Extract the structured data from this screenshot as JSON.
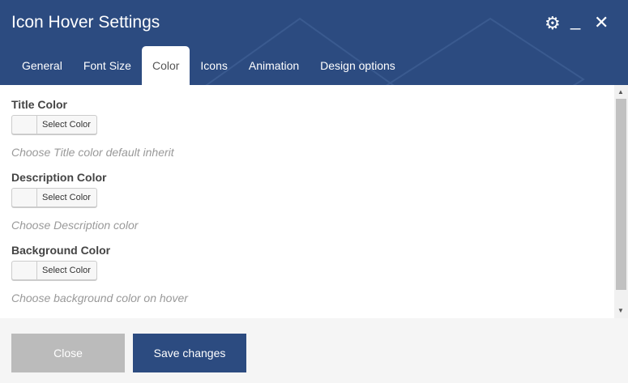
{
  "header": {
    "title": "Icon Hover Settings"
  },
  "tabs": [
    {
      "label": "General"
    },
    {
      "label": "Font Size"
    },
    {
      "label": "Color"
    },
    {
      "label": "Icons"
    },
    {
      "label": "Animation"
    },
    {
      "label": "Design options"
    }
  ],
  "active_tab": "Color",
  "fields": [
    {
      "label": "Title Color",
      "button": "Select Color",
      "hint": "Choose Title color default inherit"
    },
    {
      "label": "Description Color",
      "button": "Select Color",
      "hint": "Choose Description color"
    },
    {
      "label": "Background Color",
      "button": "Select Color",
      "hint": "Choose background color on hover"
    }
  ],
  "footer": {
    "close": "Close",
    "save": "Save changes"
  },
  "colors": {
    "header": "#2c4b80",
    "save": "#2c4b80",
    "close": "#bbbbbb"
  }
}
